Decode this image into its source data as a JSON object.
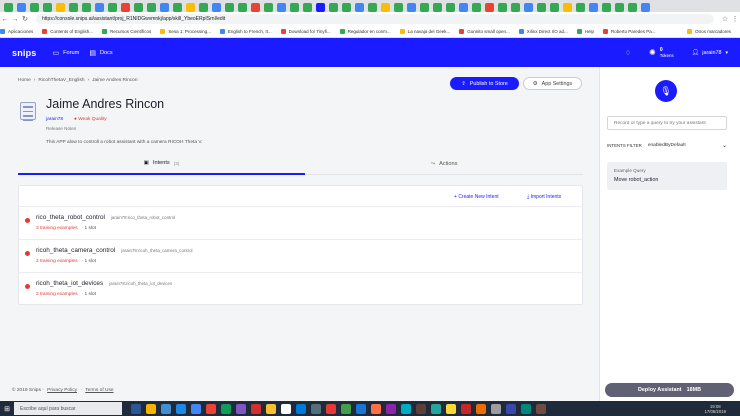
{
  "browser": {
    "url": "https://console.snips.ai/assistant/proj_R1NIDGwvmnkj/app/skill_YbeoERpISrnl/edit",
    "tab_colors": [
      "#34a853",
      "#4285f4",
      "#34a853",
      "#34a853",
      "#fbbc05",
      "#34a853",
      "#34a853",
      "#4285f4",
      "#34a853",
      "#ea4335",
      "#34a853",
      "#34a853",
      "#4285f4",
      "#34a853",
      "#fbbc05",
      "#34a853",
      "#4285f4",
      "#34a853",
      "#34a853",
      "#ea4335",
      "#34a853",
      "#4285f4",
      "#34a853",
      "#34a853",
      "#1b1bff",
      "#34a853",
      "#34a853",
      "#4285f4",
      "#34a853",
      "#fbbc05",
      "#34a853",
      "#4285f4",
      "#34a853",
      "#34a853",
      "#34a853",
      "#4285f4",
      "#34a853",
      "#ea4335",
      "#34a853",
      "#34a853",
      "#4285f4",
      "#34a853",
      "#34a853",
      "#fbbc05",
      "#34a853",
      "#4285f4",
      "#34a853",
      "#34a853",
      "#34a853",
      "#4285f4"
    ],
    "bookmarks": [
      {
        "label": "Aplicaciones",
        "color": "#4285f4"
      },
      {
        "label": "Contents of English...",
        "color": "#ea4335"
      },
      {
        "label": "Recursos Científicos",
        "color": "#34a853"
      },
      {
        "label": "Sesa 1: Processing...",
        "color": "#fbbc05"
      },
      {
        "label": "English to French, It...",
        "color": "#4285f4"
      },
      {
        "label": "Download for Tinyfi...",
        "color": "#ea4335"
      },
      {
        "label": "Regulador en conm...",
        "color": "#34a853"
      },
      {
        "label": "La navaja del Geek...",
        "color": "#fbbc05"
      },
      {
        "label": "Gunnito small open...",
        "color": "#ea4335"
      },
      {
        "label": "Xilinx Direct I/O ad...",
        "color": "#4285f4"
      },
      {
        "label": "Help",
        "color": "#34a853"
      },
      {
        "label": "Roberto Paredes Pa...",
        "color": "#ea4335"
      },
      {
        "label": "Otros marcadores",
        "color": "#fbbc05"
      }
    ]
  },
  "header": {
    "logo": "snips",
    "forum": "Forum",
    "docs": "Docs",
    "tokens_count": "0",
    "tokens_label": "Tokens",
    "user": "jarain78"
  },
  "breadcrumb": [
    "Home",
    "RicohThetaV_English",
    "Jaime Andres Rincon"
  ],
  "app": {
    "title": "Jaime Andres Rincon",
    "author": "jarain78",
    "quality": "Weak Quality",
    "release_notes": "Release Notes",
    "description": "This APP alow to controll a robot assistant with a camera RICOH Theta V."
  },
  "buttons": {
    "publish": "Publish to Store",
    "app_settings": "App Settings",
    "create_intent": "Create New Intent",
    "import_intents": "Import Intents"
  },
  "tabs": {
    "intents": "Intents",
    "intents_count": "(3)",
    "actions": "Actions"
  },
  "intents": [
    {
      "name": "rico_theta_robot_control",
      "slug": "jarain78:rico_theta_robot_control",
      "examples": "3 training examples",
      "slots": "1 slot"
    },
    {
      "name": "ricoh_theta_camera_control",
      "slug": "jarain78:ricoh_theta_camera_control",
      "examples": "2 training examples",
      "slots": "1 slot"
    },
    {
      "name": "ricoh_theta_iot_devices",
      "slug": "jarain78:ricoh_theta_iot_devices",
      "examples": "2 training examples",
      "slots": "1 slot"
    }
  ],
  "footer": {
    "copyright": "© 2019 Snips",
    "privacy": "Privacy Policy",
    "terms": "Terms of Use"
  },
  "panel": {
    "query_placeholder": "Record or type a query to try your assistant",
    "filter_label": "INTENTS FILTER",
    "filter_value": "enabledByDefault",
    "example_label": "Example Query",
    "example_query": "Move robot_action",
    "deploy": "Deploy Assistant",
    "deploy_size": "18MB"
  },
  "taskbar": {
    "search": "Escribe aquí para buscar",
    "time": "19:08",
    "date": "17/06/2019",
    "app_colors": [
      "#2b5797",
      "#f4b400",
      "#3f8fd2",
      "#1e88e5",
      "#4285f4",
      "#ea4335",
      "#0f9d58",
      "#7e57c2",
      "#d32f2f",
      "#fbc02d",
      "#ffffff",
      "#0078d7",
      "#546e7a",
      "#e53935",
      "#43a047",
      "#1976d2",
      "#ff7043",
      "#8e24aa",
      "#00acc1",
      "#5d4037",
      "#26a69a",
      "#fdd835",
      "#c62828",
      "#ef6c00",
      "#9e9e9e",
      "#3949ab",
      "#00897b",
      "#6d4c41"
    ]
  },
  "colors": {
    "primary": "#1b1bff",
    "error": "#e53935",
    "deploy_bg": "#616175"
  }
}
